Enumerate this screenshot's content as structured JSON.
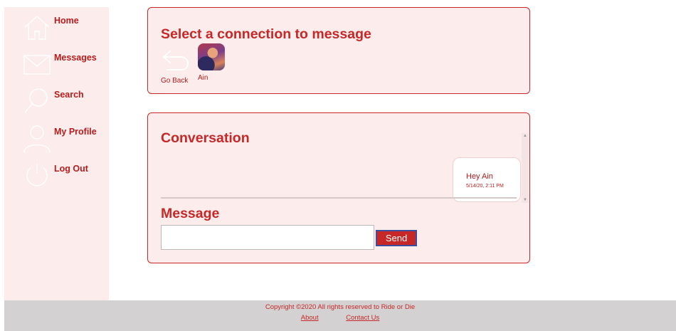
{
  "sidebar": {
    "items": [
      {
        "label": "Home",
        "icon": "home-icon"
      },
      {
        "label": "Messages",
        "icon": "envelope-icon"
      },
      {
        "label": "Search",
        "icon": "search-icon"
      },
      {
        "label": "My Profile",
        "icon": "user-icon"
      },
      {
        "label": "Log Out",
        "icon": "power-icon"
      }
    ]
  },
  "connections": {
    "title": "Select a connection to message",
    "back_label": "Go Back",
    "items": [
      {
        "name": "Ain"
      }
    ]
  },
  "conversation": {
    "title": "Conversation",
    "messages": [
      {
        "text": "Hey Ain",
        "timestamp": "5/14/20, 2:11 PM"
      }
    ]
  },
  "compose": {
    "title": "Message",
    "input_value": "",
    "send_label": "Send"
  },
  "footer": {
    "copyright": "Copyright ©2020 All rights reserved to Ride or Die",
    "links": [
      "About",
      "Contact Us"
    ]
  },
  "colors": {
    "accent": "#c62828",
    "panel_bg": "#fdecec",
    "footer_bg": "#d3d1d1"
  }
}
